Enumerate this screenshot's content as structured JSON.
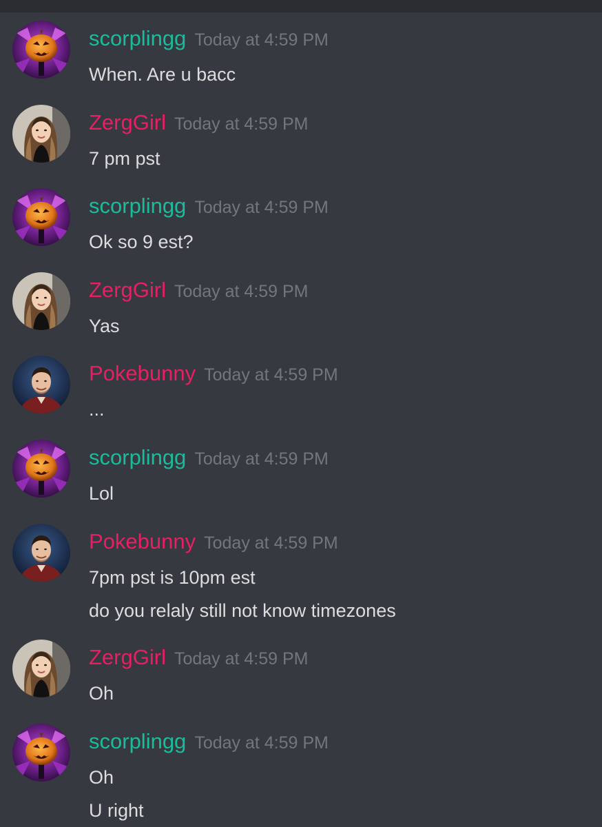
{
  "colors": {
    "background": "#36393f",
    "topbar": "#2b2d31",
    "timestamp": "#72767d",
    "message_text": "#dcddde"
  },
  "users": {
    "scorplingg": {
      "name": "scorplingg",
      "color": "#1abc9c",
      "avatar": "purple-pumpkin-avatar"
    },
    "zerggirl": {
      "name": "ZergGirl",
      "color": "#e91e63",
      "avatar": "woman-photo-avatar"
    },
    "pokebunny": {
      "name": "Pokebunny",
      "color": "#e91e63",
      "avatar": "man-photo-avatar"
    }
  },
  "messages": [
    {
      "user": "scorplingg",
      "timestamp": "Today at 4:59 PM",
      "lines": [
        "When. Are u bacc"
      ]
    },
    {
      "user": "zerggirl",
      "timestamp": "Today at 4:59 PM",
      "lines": [
        "7 pm pst"
      ]
    },
    {
      "user": "scorplingg",
      "timestamp": "Today at 4:59 PM",
      "lines": [
        "Ok so 9 est?"
      ]
    },
    {
      "user": "zerggirl",
      "timestamp": "Today at 4:59 PM",
      "lines": [
        "Yas"
      ]
    },
    {
      "user": "pokebunny",
      "timestamp": "Today at 4:59 PM",
      "lines": [
        "..."
      ]
    },
    {
      "user": "scorplingg",
      "timestamp": "Today at 4:59 PM",
      "lines": [
        "Lol"
      ]
    },
    {
      "user": "pokebunny",
      "timestamp": "Today at 4:59 PM",
      "lines": [
        "7pm pst is 10pm est",
        "do you relaly still not know timezones"
      ]
    },
    {
      "user": "zerggirl",
      "timestamp": "Today at 4:59 PM",
      "lines": [
        "Oh"
      ]
    },
    {
      "user": "scorplingg",
      "timestamp": "Today at 4:59 PM",
      "lines": [
        "Oh",
        "U right"
      ]
    }
  ]
}
